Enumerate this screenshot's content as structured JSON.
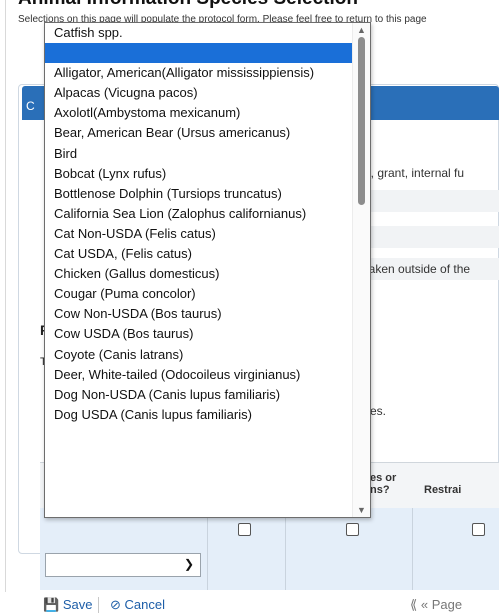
{
  "page": {
    "heading": "Animal Information Species Selection",
    "instructions": "Selections on this page will populate the protocol form. Please feel free to return to this page"
  },
  "card": {
    "header_label": "C",
    "bg_line_funding": "ds, grant, internal fu",
    "bg_line_q": "?",
    "bg_line_taken": "r taken outside of the",
    "bg_line_applies": "plies.",
    "left_heading": "R",
    "left_small": "T"
  },
  "grid": {
    "columns": [
      "es or\nns?",
      "Restrai"
    ],
    "select_value": ""
  },
  "footer": {
    "save_label": "Save",
    "cancel_label": "Cancel",
    "page_label": "Page"
  },
  "dropdown": {
    "selected_index": 1,
    "items": [
      "Catfish spp.",
      "",
      "Alligator, American(Alligator mississippiensis)",
      "Alpacas (Vicugna pacos)",
      "Axolotl(Ambystoma mexicanum)",
      "Bear, American Bear (Ursus americanus)",
      "Bird",
      "Bobcat (Lynx rufus)",
      "Bottlenose Dolphin (Tursiops truncatus)",
      "California Sea Lion (Zalophus californianus)",
      "Cat Non-USDA (Felis catus)",
      "Cat USDA, (Felis catus)",
      "Chicken (Gallus domesticus)",
      "Cougar (Puma concolor)",
      "Cow Non-USDA (Bos taurus)",
      "Cow USDA (Bos taurus)",
      "Coyote (Canis latrans)",
      "Deer, White-tailed (Odocoileus virginianus)",
      "Dog Non-USDA (Canis lupus familiaris)",
      "Dog USDA (Canis lupus familiaris)"
    ],
    "scroll_fraction": 0.0
  },
  "colors": {
    "accent": "#2a6fb8",
    "selection": "#1a6fd8",
    "link": "#1d5ea8"
  }
}
